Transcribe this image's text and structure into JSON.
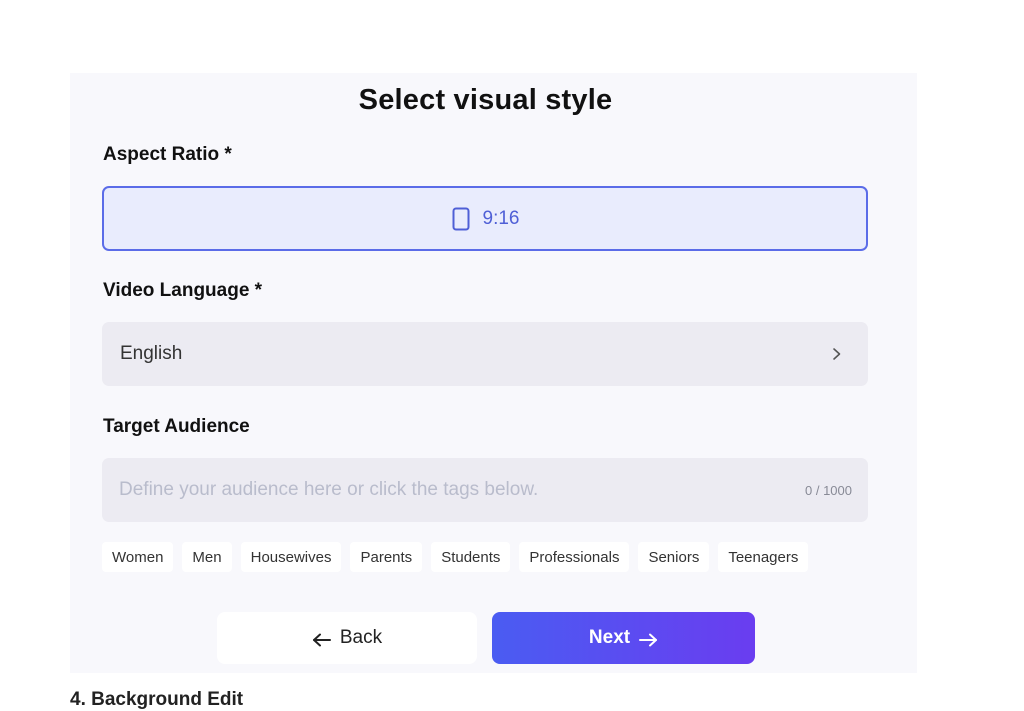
{
  "header": {
    "title": "Select visual style"
  },
  "aspect_ratio": {
    "label": "Aspect Ratio *",
    "selected": "9:16",
    "icon": "phone-portrait-icon"
  },
  "video_language": {
    "label": "Video Language *",
    "selected": "English",
    "icon": "chevron-right-icon"
  },
  "target_audience": {
    "label": "Target Audience",
    "value": "",
    "placeholder": "Define your audience here or click the tags below.",
    "counter": "0 / 1000",
    "tags": [
      "Women",
      "Men",
      "Housewives",
      "Parents",
      "Students",
      "Professionals",
      "Seniors",
      "Teenagers"
    ]
  },
  "actions": {
    "back_label": "Back",
    "next_label": "Next"
  },
  "footer_hint": "4. Background Edit",
  "colors": {
    "accent": "#5b6ce8",
    "next_gradient_start": "#4a5cf2",
    "next_gradient_end": "#6a3df0",
    "panel_bg": "#f8f8fc",
    "field_bg": "#ecebf2"
  }
}
